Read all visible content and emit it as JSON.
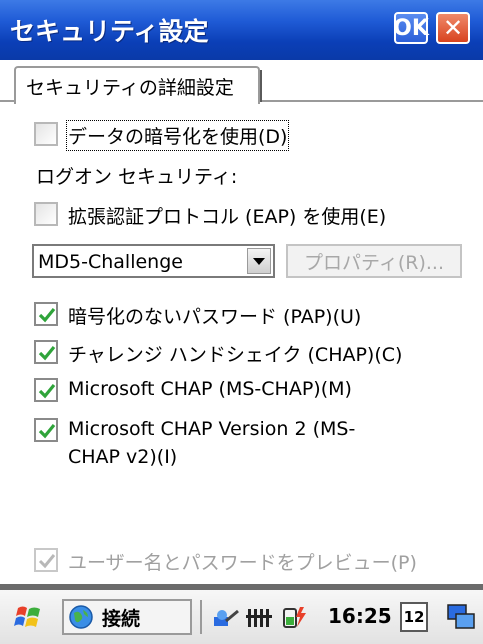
{
  "window": {
    "title": "セキュリティ設定",
    "ok_label": "OK",
    "close_label": "✕"
  },
  "tab": {
    "label": "セキュリティの詳細設定"
  },
  "options": {
    "encrypt_data": {
      "label": "データの暗号化を使用(D)",
      "checked": false
    },
    "logon_security_label": "ログオン セキュリティ:",
    "use_eap": {
      "label": "拡張認証プロトコル (EAP) を使用(E)",
      "checked": false
    },
    "eap_select_value": "MD5-Challenge",
    "properties_button": "プロパティ(R)...",
    "pap": {
      "label": "暗号化のないパスワード (PAP)(U)",
      "checked": true
    },
    "chap": {
      "label": "チャレンジ ハンドシェイク (CHAP)(C)",
      "checked": true
    },
    "ms_chap": {
      "label": "Microsoft CHAP (MS-CHAP)(M)",
      "checked": true
    },
    "ms_chap_v2": {
      "label_line1": "Microsoft CHAP Version 2 (MS-",
      "label_line2": "CHAP v2)(I)",
      "checked": true
    },
    "preview": {
      "label": "ユーザー名とパスワードをプレビュー(P)",
      "checked": true,
      "disabled": true
    }
  },
  "taskbar": {
    "connect_label": "接続",
    "clock": "16:25",
    "date_icon": "12",
    "icons": [
      "windows-start-icon",
      "globe-icon",
      "network-icon",
      "signal-icon",
      "battery-icon",
      "calendar-icon",
      "desktop-icon"
    ]
  },
  "colors": {
    "title_blue": "#1f5bd6",
    "check_green": "#2fa43a",
    "disabled_gray": "#a0a0a0"
  }
}
